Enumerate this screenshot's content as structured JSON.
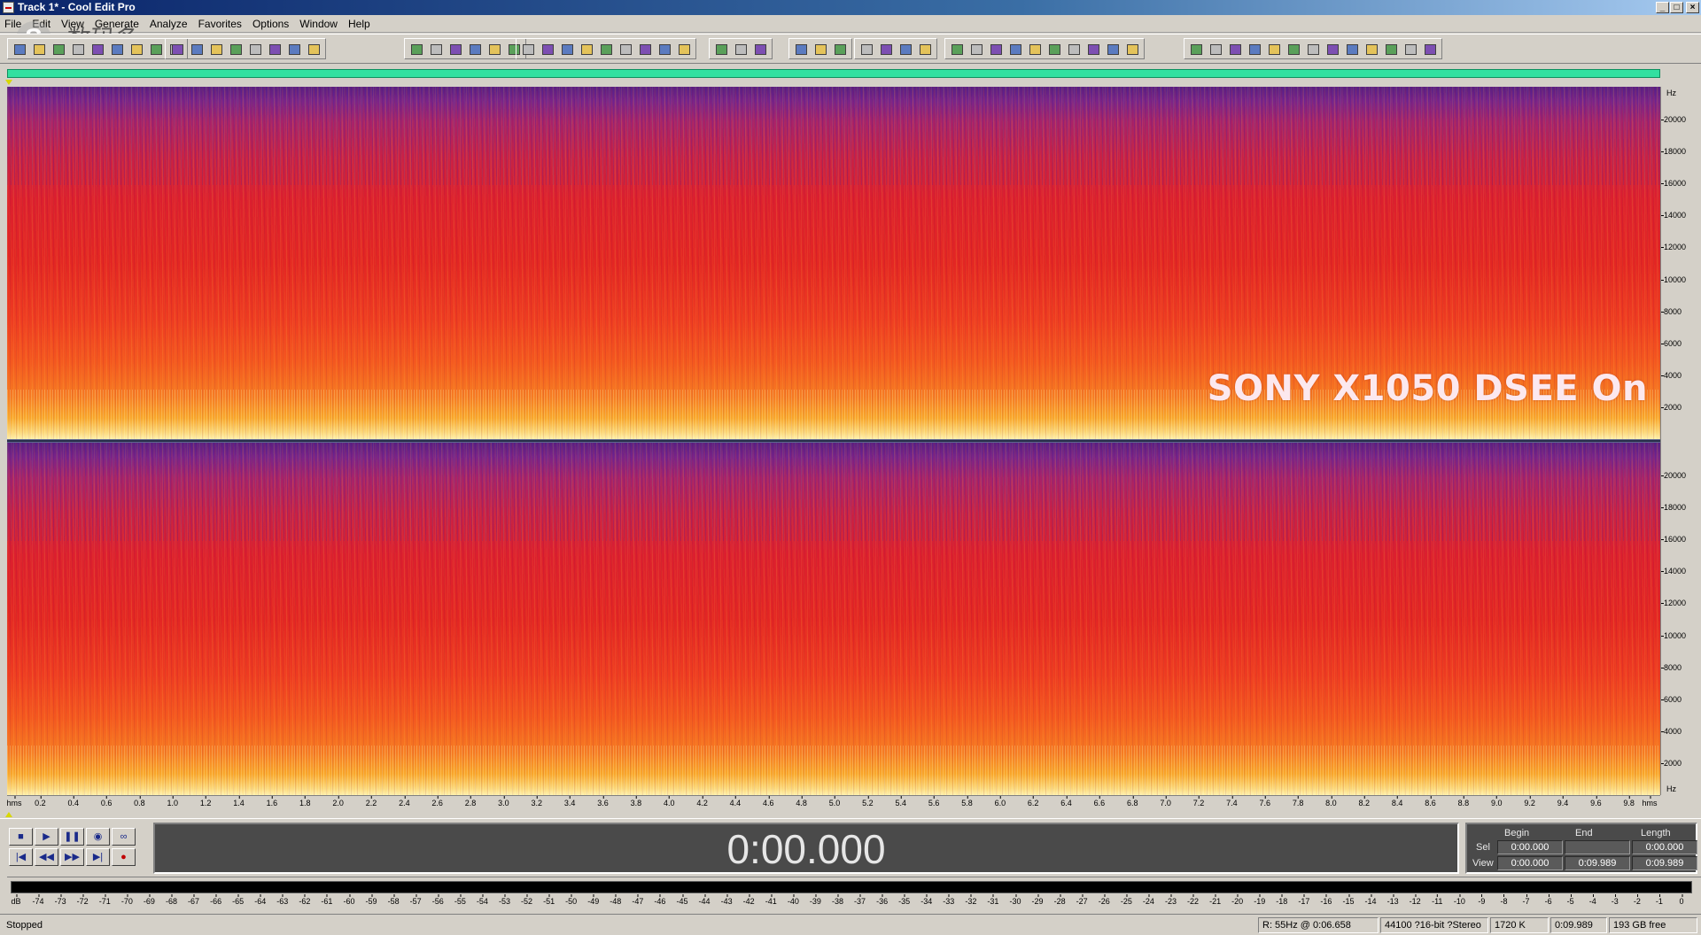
{
  "window": {
    "title": "Track 1* - Cool Edit Pro",
    "controls": [
      "_",
      "□",
      "×"
    ]
  },
  "menu": [
    "File",
    "Edit",
    "View",
    "Generate",
    "Analyze",
    "Favorites",
    "Options",
    "Window",
    "Help"
  ],
  "watermark": {
    "logo": "S",
    "cn_text": "数码多",
    "url": "soomal.com"
  },
  "toolbar_icons": [
    "waveform-spectral-toggle-icon",
    "multitrack-icon",
    "open-icon",
    "save-icon",
    "close-icon",
    "undo-icon",
    "redo-icon",
    "cut-icon",
    "copy-icon",
    "paste-icon",
    "mix-paste-icon",
    "trim-icon",
    "delete-icon",
    "silence-icon",
    "select-all-icon",
    "select-view-icon",
    "find-icon",
    "amplify-icon",
    "normalize-icon",
    "fade-icon",
    "envelope-icon",
    "invert-icon",
    "reverse-icon",
    "zoom-in-icon",
    "zoom-out-icon",
    "zoom-full-icon",
    "play-icon",
    "loop-icon",
    "time-format-icon",
    "bars-beats-icon",
    "marker-icon",
    "cue-list-icon",
    "favorites-icon",
    "script-icon",
    "help-icon",
    "spectral-view-icon",
    "frequency-analysis-icon",
    "scan-icon",
    "eq-icon",
    "graphic-eq-icon",
    "parametric-eq-icon",
    "filter-icon",
    "delay-icon",
    "echo-icon",
    "chorus-icon",
    "flanger-icon",
    "reverb-icon",
    "noise-reduction-icon",
    "click-remove-icon",
    "hiss-icon",
    "clip-restore-icon",
    "compressor-icon",
    "hard-limit-icon",
    "pitch-icon",
    "stretch-icon",
    "bend-icon",
    "vibrato-icon",
    "pan-icon",
    "spectrum-icon",
    "tone-icon",
    "dtmf-icon",
    "noise-gen-icon",
    "brainwave-icon",
    "convolution-icon",
    "scientific-filter-icon"
  ],
  "spectrogram": {
    "overlay_text": "SONY X1050 DSEE On",
    "hz_unit": "Hz",
    "hz_ticks": [
      "20000",
      "18000",
      "16000",
      "14000",
      "12000",
      "10000",
      "8000",
      "6000",
      "4000",
      "2000"
    ],
    "time_unit": "hms",
    "time_ticks": [
      "0.2",
      "0.4",
      "0.6",
      "0.8",
      "1.0",
      "1.2",
      "1.4",
      "1.6",
      "1.8",
      "2.0",
      "2.2",
      "2.4",
      "2.6",
      "2.8",
      "3.0",
      "3.2",
      "3.4",
      "3.6",
      "3.8",
      "4.0",
      "4.2",
      "4.4",
      "4.6",
      "4.8",
      "5.0",
      "5.2",
      "5.4",
      "5.6",
      "5.8",
      "6.0",
      "6.2",
      "6.4",
      "6.6",
      "6.8",
      "7.0",
      "7.2",
      "7.4",
      "7.6",
      "7.8",
      "8.0",
      "8.2",
      "8.4",
      "8.6",
      "8.8",
      "9.0",
      "9.2",
      "9.4",
      "9.6",
      "9.8"
    ]
  },
  "transport": {
    "buttons": [
      {
        "name": "stop-button",
        "glyph": "■"
      },
      {
        "name": "play-button",
        "glyph": "▶"
      },
      {
        "name": "pause-button",
        "glyph": "❚❚"
      },
      {
        "name": "play-to-end-button",
        "glyph": "◉"
      },
      {
        "name": "loop-button",
        "glyph": "∞"
      },
      {
        "name": "go-to-beginning-button",
        "glyph": "|◀"
      },
      {
        "name": "rewind-button",
        "glyph": "◀◀"
      },
      {
        "name": "fast-forward-button",
        "glyph": "▶▶"
      },
      {
        "name": "go-to-end-button",
        "glyph": "▶|"
      },
      {
        "name": "record-button",
        "glyph": "●"
      }
    ]
  },
  "time_display": "0:00.000",
  "selection": {
    "headers": [
      "Begin",
      "End",
      "Length"
    ],
    "sel_label": "Sel",
    "view_label": "View",
    "sel": {
      "begin": "0:00.000",
      "end": "",
      "length": "0:00.000"
    },
    "view": {
      "begin": "0:00.000",
      "end": "0:09.989",
      "length": "0:09.989"
    }
  },
  "level_meter": {
    "ticks": [
      "dB",
      "-74",
      "-73",
      "-72",
      "-71",
      "-70",
      "-69",
      "-68",
      "-67",
      "-66",
      "-65",
      "-64",
      "-63",
      "-62",
      "-61",
      "-60",
      "-59",
      "-58",
      "-57",
      "-56",
      "-55",
      "-54",
      "-53",
      "-52",
      "-51",
      "-50",
      "-49",
      "-48",
      "-47",
      "-46",
      "-45",
      "-44",
      "-43",
      "-42",
      "-41",
      "-40",
      "-39",
      "-38",
      "-37",
      "-36",
      "-35",
      "-34",
      "-33",
      "-32",
      "-31",
      "-30",
      "-29",
      "-28",
      "-27",
      "-26",
      "-25",
      "-24",
      "-23",
      "-22",
      "-21",
      "-20",
      "-19",
      "-18",
      "-17",
      "-16",
      "-15",
      "-14",
      "-13",
      "-12",
      "-11",
      "-10",
      "-9",
      "-8",
      "-7",
      "-6",
      "-5",
      "-4",
      "-3",
      "-2",
      "-1",
      "0"
    ]
  },
  "status": {
    "state": "Stopped",
    "cursor": "R: 55Hz @  0:06.658",
    "format": "44100 ?16-bit ?Stereo",
    "size": "1720 K",
    "duration": "0:09.989",
    "free": "193 GB free"
  },
  "colors": {
    "title_gradient_start": "#0a246a",
    "overview_bar": "#33e0a0",
    "spectrum_low": "#fff2b2",
    "spectrum_mid": "#e32623",
    "spectrum_high": "#5a1e82",
    "display_bg": "#4a4a4a"
  }
}
